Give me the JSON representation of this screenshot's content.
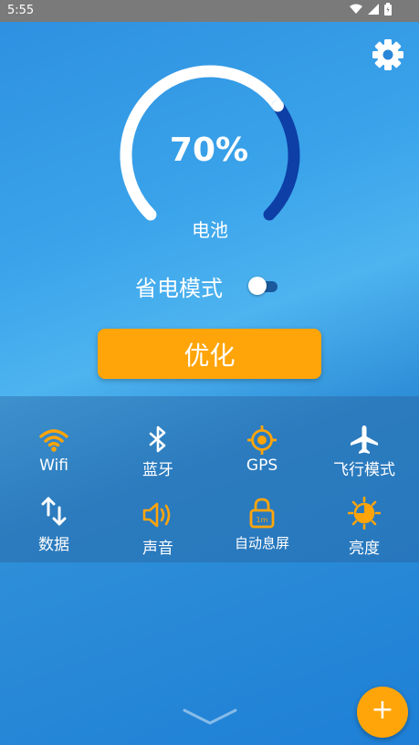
{
  "status": {
    "time": "5:55",
    "icons": [
      "wifi-icon",
      "signal-icon",
      "battery-icon"
    ]
  },
  "settings_icon": "gear-icon",
  "battery": {
    "percent": "70%",
    "level": 0.7,
    "label": "电池"
  },
  "power_saving": {
    "label": "省电模式",
    "enabled": false
  },
  "optimize_label": "优化",
  "quick_settings": [
    {
      "key": "wifi",
      "label": "Wifi",
      "icon": "wifi-icon",
      "color": "#ffa50a"
    },
    {
      "key": "bluetooth",
      "label": "蓝牙",
      "icon": "bluetooth-icon",
      "color": "#ffffff"
    },
    {
      "key": "gps",
      "label": "GPS",
      "icon": "gps-icon",
      "color": "#ffa50a"
    },
    {
      "key": "airplane",
      "label": "飞行模式",
      "icon": "airplane-icon",
      "color": "#ffffff"
    },
    {
      "key": "data",
      "label": "数据",
      "icon": "data-arrows-icon",
      "color": "#ffffff"
    },
    {
      "key": "sound",
      "label": "声音",
      "icon": "speaker-icon",
      "color": "#ffa50a"
    },
    {
      "key": "screen_timeout",
      "label": "自动息屏",
      "icon": "lock-timer-icon",
      "color": "#ffa50a",
      "badge": "1m"
    },
    {
      "key": "brightness",
      "label": "亮度",
      "icon": "brightness-icon",
      "color": "#ffa50a"
    }
  ],
  "expand_icon": "chevron-down-icon",
  "fab_label": "+",
  "colors": {
    "accent": "#ffa50a",
    "gauge_active": "#0d3fa6",
    "status_bar": "#7a7a7a"
  }
}
